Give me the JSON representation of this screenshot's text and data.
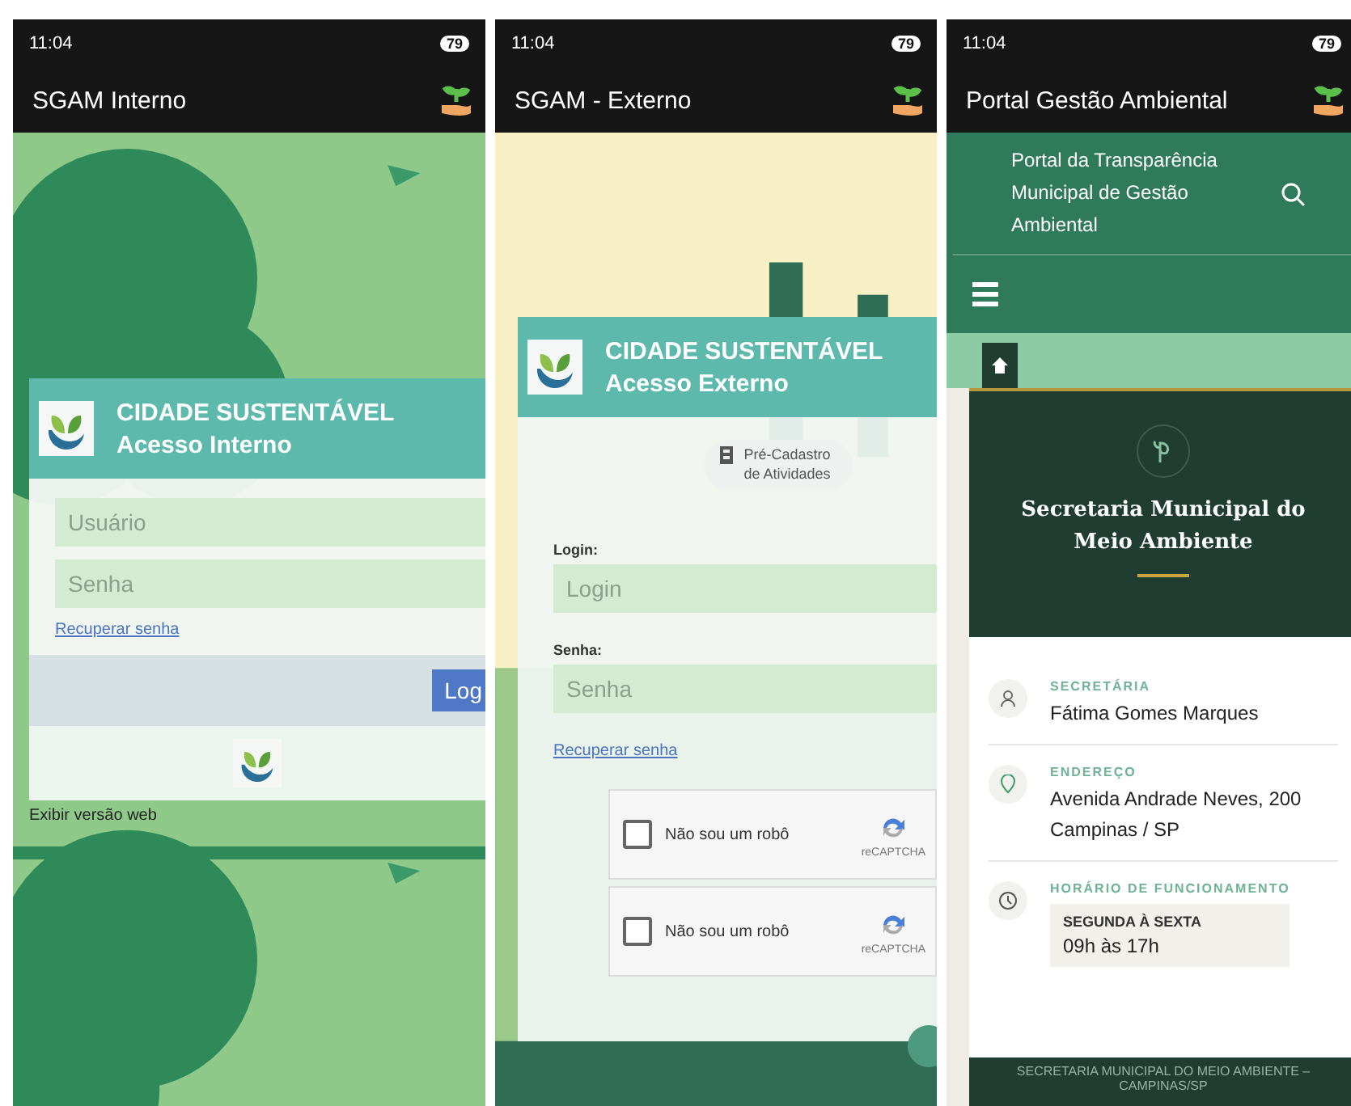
{
  "phones": [
    {
      "kind": "internal",
      "status": {
        "time": "11:04",
        "battery": "79"
      },
      "app_title": "SGAM Interno",
      "card": {
        "title": "CIDADE SUSTENTÁVEL",
        "subtitle": "Acesso Interno"
      },
      "fields": [
        {
          "placeholder": "Usuário"
        },
        {
          "placeholder": "Senha"
        }
      ],
      "recover_link": "Recuperar senha",
      "login_button": "Log",
      "web_link": "Exibir versão web"
    },
    {
      "kind": "external",
      "status": {
        "time": "11:04",
        "battery": "79"
      },
      "app_title": "SGAM - Externo",
      "card": {
        "title": "CIDADE SUSTENTÁVEL",
        "subtitle": "Acesso Externo"
      },
      "pre_register_button": "Pré-Cadastro de Atividades",
      "fields": [
        {
          "label": "Login:",
          "placeholder": "Login"
        },
        {
          "label": "Senha:",
          "placeholder": "Senha"
        }
      ],
      "recover_link": "Recuperar senha",
      "captchas": [
        {
          "label": "Não sou um robô",
          "brand": "reCAPTCHA",
          "checked": false
        },
        {
          "label": "Não sou um robô",
          "brand": "reCAPTCHA",
          "checked": false
        }
      ]
    },
    {
      "kind": "portal",
      "status": {
        "time": "11:04",
        "battery": "79"
      },
      "app_title": "Portal Gestão Ambiental",
      "site_title": "Portal da Transparência Municipal de Gestão Ambiental",
      "hero_title": "Secretaria Municipal do Meio Ambiente",
      "info": [
        {
          "kind": "person",
          "label": "SECRETÁRIA",
          "lines": [
            "Fátima Gomes Marques"
          ]
        },
        {
          "kind": "pin",
          "label": "ENDEREÇO",
          "lines": [
            "Avenida Andrade Neves, 200",
            "Campinas / SP"
          ]
        },
        {
          "kind": "clock",
          "label": "HORÁRIO DE FUNCIONAMENTO",
          "hours": {
            "days": "SEGUNDA À SEXTA",
            "time": "09h às 17h"
          }
        }
      ],
      "footer": "SECRETARIA MUNICIPAL DO MEIO AMBIENTE – CAMPINAS/SP"
    }
  ]
}
